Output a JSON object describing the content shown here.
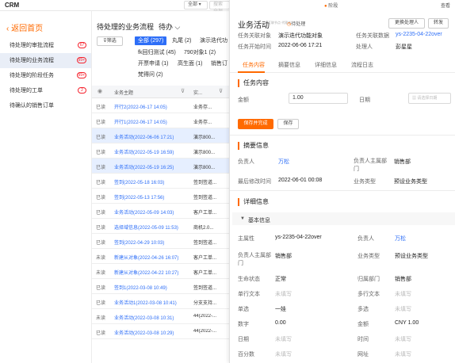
{
  "topbar": {
    "logo": "CRM",
    "scope_select": "全部 ▾",
    "search_placeholder": "搜索全部",
    "stage_label": "阶段",
    "view_link": "查看"
  },
  "sidebar": {
    "back_label": "返回首页",
    "items": [
      {
        "label": "待处理的审批流程",
        "badge": "67"
      },
      {
        "label": "待处理的业务流程",
        "badge": "99+"
      },
      {
        "label": "待处理的阶段任务",
        "badge": "99+"
      },
      {
        "label": "待处理的工单",
        "badge": "2"
      },
      {
        "label": "待确认的销售订单",
        "badge": ""
      }
    ]
  },
  "list": {
    "title": "待处理的业务流程",
    "view": "待办",
    "filter_label": "筛选",
    "chips": [
      "全部 (297)",
      "丸尾 (2)",
      "演示迭代功",
      "fk回归测试 (45)",
      "790对象1 (2)",
      "开票申请 (1)",
      "高生面 (1)",
      "销售订",
      "梵得问 (2)"
    ],
    "headers": [
      "业务主题",
      "实..."
    ],
    "rows": [
      {
        "status": "已读",
        "subject": "开行2(2022-06-17 14:05)",
        "type": "业务存..."
      },
      {
        "status": "已读",
        "subject": "开行1(2022-06-17 14:05)",
        "type": "业务存..."
      },
      {
        "status": "已读",
        "subject": "业务活动(2022-06-06 17:21)",
        "type": "演示800..."
      },
      {
        "status": "已读",
        "subject": "业务活动(2022-05-19 16:59)",
        "type": "演示800..."
      },
      {
        "status": "已读",
        "subject": "业务活动(2022-05-19 16:25)",
        "type": "演示800..."
      },
      {
        "status": "已读",
        "subject": "签到(2022-05-18 16:03)",
        "type": "签到签道..."
      },
      {
        "status": "已读",
        "subject": "签到(2022-05-13 17:56)",
        "type": "签到签道..."
      },
      {
        "status": "已读",
        "subject": "业务活动(2022-05-09 14:03)",
        "type": "客户工单..."
      },
      {
        "status": "已读",
        "subject": "选择域信息(2022-05-09 11:53)",
        "type": "商机2.0..."
      },
      {
        "status": "已读",
        "subject": "签到(2022-04-29 10:03)",
        "type": "签到签道..."
      },
      {
        "status": "未读",
        "subject": "新建从对象(2022-04-26 16:07)",
        "type": "客户工单..."
      },
      {
        "status": "未读",
        "subject": "新建从对象(2022-04-22 10:27)",
        "type": "客户工单..."
      },
      {
        "status": "已读",
        "subject": "签到1(2022-03-08 10:49)",
        "type": "签到签道..."
      },
      {
        "status": "已读",
        "subject": "业务活动1(2022-03-08 10:41)",
        "type": "分支支持..."
      },
      {
        "status": "未读",
        "subject": "业务活动(2022-03-08 10:31)",
        "type": "44(2022-..."
      },
      {
        "status": "已读",
        "subject": "业务活动(2022-03-08 10:29)",
        "type": "44(2022-..."
      }
    ]
  },
  "detail": {
    "title": "业务活动",
    "sub_note": "互联节点 代理者",
    "status": "待处理",
    "change_handler_btn": "更换处理人",
    "transfer_btn": "转发",
    "meta": [
      {
        "label": "任务关联对象",
        "value": "演示迭代功能对象"
      },
      {
        "label": "任务关联数据",
        "value": "ys-2235-04-22over"
      },
      {
        "label": "任务开始时间",
        "value": "2022-06-06 17:21"
      },
      {
        "label": "处理人",
        "value": "彭星星"
      }
    ],
    "tabs": [
      "任务内容",
      "摘要信息",
      "详细信息",
      "流程日志"
    ],
    "task_section": "任务内容",
    "amount_label": "金额",
    "amount_value": "1.00",
    "date_label": "日期",
    "date_placeholder": "请选择日期",
    "save_complete_btn": "保存并完成",
    "save_btn": "保存",
    "summary_section": "摘要信息",
    "summary": [
      {
        "label": "负责人",
        "value": "万松"
      },
      {
        "label": "负责人主属部门",
        "value": "销售部"
      },
      {
        "label": "最后修改时间",
        "value": "2022-06-01 00:08"
      },
      {
        "label": "业务类型",
        "value": "预设业务类型"
      }
    ],
    "detail_section": "详细信息",
    "basic_info": "基本信息",
    "fields": [
      {
        "label": "主属性",
        "value": "ys-2235-04-22over"
      },
      {
        "label": "负责人",
        "value": "万松"
      },
      {
        "label": "负责人主属部门",
        "value": "销售部"
      },
      {
        "label": "业务类型",
        "value": "预设业务类型"
      },
      {
        "label": "生命状态",
        "value": "正常"
      },
      {
        "label": "归属部门",
        "value": "销售部"
      },
      {
        "label": "单行文本",
        "value": "未填写"
      },
      {
        "label": "多行文本",
        "value": "未填写"
      },
      {
        "label": "单选",
        "value": "一娃"
      },
      {
        "label": "多选",
        "value": "未填写"
      },
      {
        "label": "数字",
        "value": "0.00"
      },
      {
        "label": "金额",
        "value": "CNY 1.00"
      },
      {
        "label": "日期",
        "value": "未填写"
      },
      {
        "label": "时间",
        "value": "未填写"
      },
      {
        "label": "百分数",
        "value": "未填写"
      },
      {
        "label": "网址",
        "value": "未填写"
      }
    ]
  },
  "colors": {
    "accent": "#ff6a00",
    "link": "#2d6ef7",
    "selected_row": "#e6efff",
    "badge": "#f5222d"
  }
}
